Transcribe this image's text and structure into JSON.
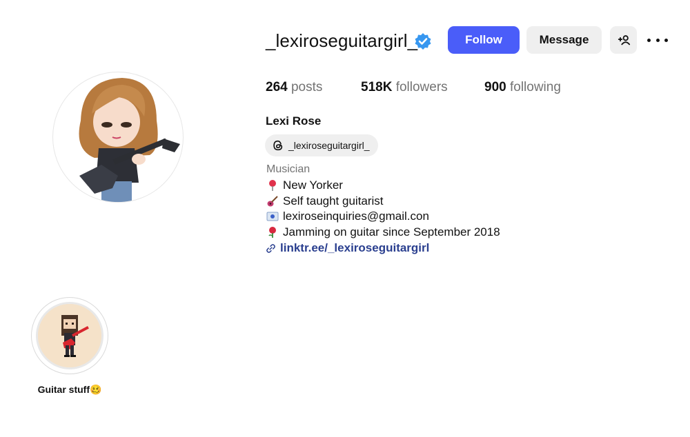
{
  "profile": {
    "username": "_lexiroseguitargirl_",
    "full_name": "Lexi Rose",
    "threads_handle": "_lexiroseguitargirl_",
    "category": "Musician",
    "bio": [
      {
        "icon": "pushpin-icon",
        "text": "New Yorker"
      },
      {
        "icon": "guitar-icon",
        "text": "Self taught guitarist"
      },
      {
        "icon": "envelope-icon",
        "text": "lexiroseinquiries@gmail.con"
      },
      {
        "icon": "rose-icon",
        "text": "Jamming on guitar since September 2018"
      }
    ],
    "link": "linktr.ee/_lexiroseguitargirl"
  },
  "actions": {
    "follow_label": "Follow",
    "message_label": "Message",
    "add_user_label": "+"
  },
  "stats": {
    "posts_count": "264",
    "posts_label": "posts",
    "followers_count": "518K",
    "followers_label": "followers",
    "following_count": "900",
    "following_label": "following"
  },
  "highlights": [
    {
      "label": "Guitar stuff🥴"
    }
  ],
  "colors": {
    "accent": "#4a5df9",
    "verified": "#3797f0",
    "link": "#2a3f8f",
    "secondary_text": "#737373",
    "button_bg": "#efefef"
  }
}
